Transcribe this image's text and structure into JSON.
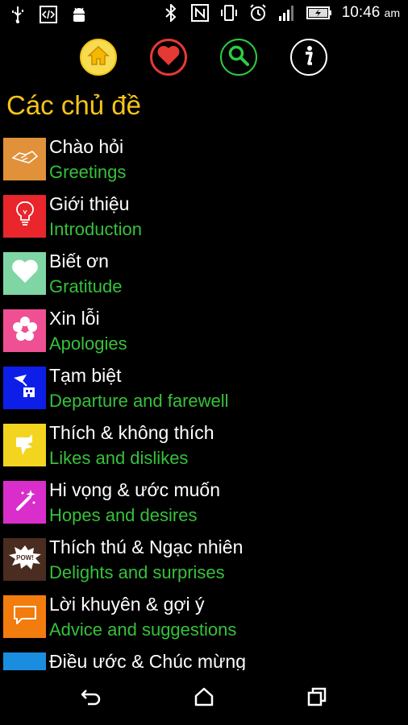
{
  "status_bar": {
    "left_icons": [
      "usb-icon",
      "code-icon",
      "android-icon"
    ],
    "right_icons": [
      "bluetooth-icon",
      "nfc-icon",
      "vibrate-icon",
      "alarm-icon",
      "signal-icon",
      "battery-charging-icon"
    ],
    "time": "10:46",
    "ampm": "am"
  },
  "toolbar": {
    "buttons": [
      {
        "name": "home",
        "icon": "home-icon",
        "color": "#f7dc52"
      },
      {
        "name": "favorites",
        "icon": "heart-icon",
        "color": "#e53935"
      },
      {
        "name": "search",
        "icon": "search-icon",
        "color": "#2ecc40"
      },
      {
        "name": "info",
        "icon": "info-icon",
        "color": "#ffffff"
      }
    ]
  },
  "page": {
    "title": "Các chủ đề"
  },
  "topics": [
    {
      "vi": "Chào hỏi",
      "en": "Greetings",
      "color": "#e0913a",
      "icon": "handshake-icon"
    },
    {
      "vi": "Giới thiệu",
      "en": "Introduction",
      "color": "#e8262b",
      "icon": "lightbulb-icon"
    },
    {
      "vi": "Biết ơn",
      "en": "Gratitude",
      "color": "#7fd6a4",
      "icon": "heart-icon"
    },
    {
      "vi": "Xin lỗi",
      "en": "Apologies",
      "color": "#ef4f93",
      "icon": "flower-icon"
    },
    {
      "vi": "Tạm biệt",
      "en": "Departure and farewell",
      "color": "#0d1ee8",
      "icon": "departure-icon"
    },
    {
      "vi": "Thích & không thích",
      "en": "Likes and dislikes",
      "color": "#f3d51f",
      "icon": "likes-icon"
    },
    {
      "vi": "Hi vọng & ước muốn",
      "en": "Hopes and desires",
      "color": "#d92ecb",
      "icon": "magic-wand-icon"
    },
    {
      "vi": "Thích thú & Ngạc nhiên",
      "en": "Delights and surprises",
      "color": "#4a2c20",
      "icon": "pow-icon",
      "icon_text": "POW!"
    },
    {
      "vi": "Lời khuyên & gợi ý",
      "en": "Advice and suggestions",
      "color": "#f27c0e",
      "icon": "speech-bubble-icon"
    },
    {
      "vi": "Điều ước & Chúc mừng",
      "en": "",
      "color": "#1a8de0",
      "icon": "wishes-icon"
    }
  ],
  "nav_bar": {
    "buttons": [
      "back-icon",
      "home-icon",
      "recents-icon"
    ]
  }
}
